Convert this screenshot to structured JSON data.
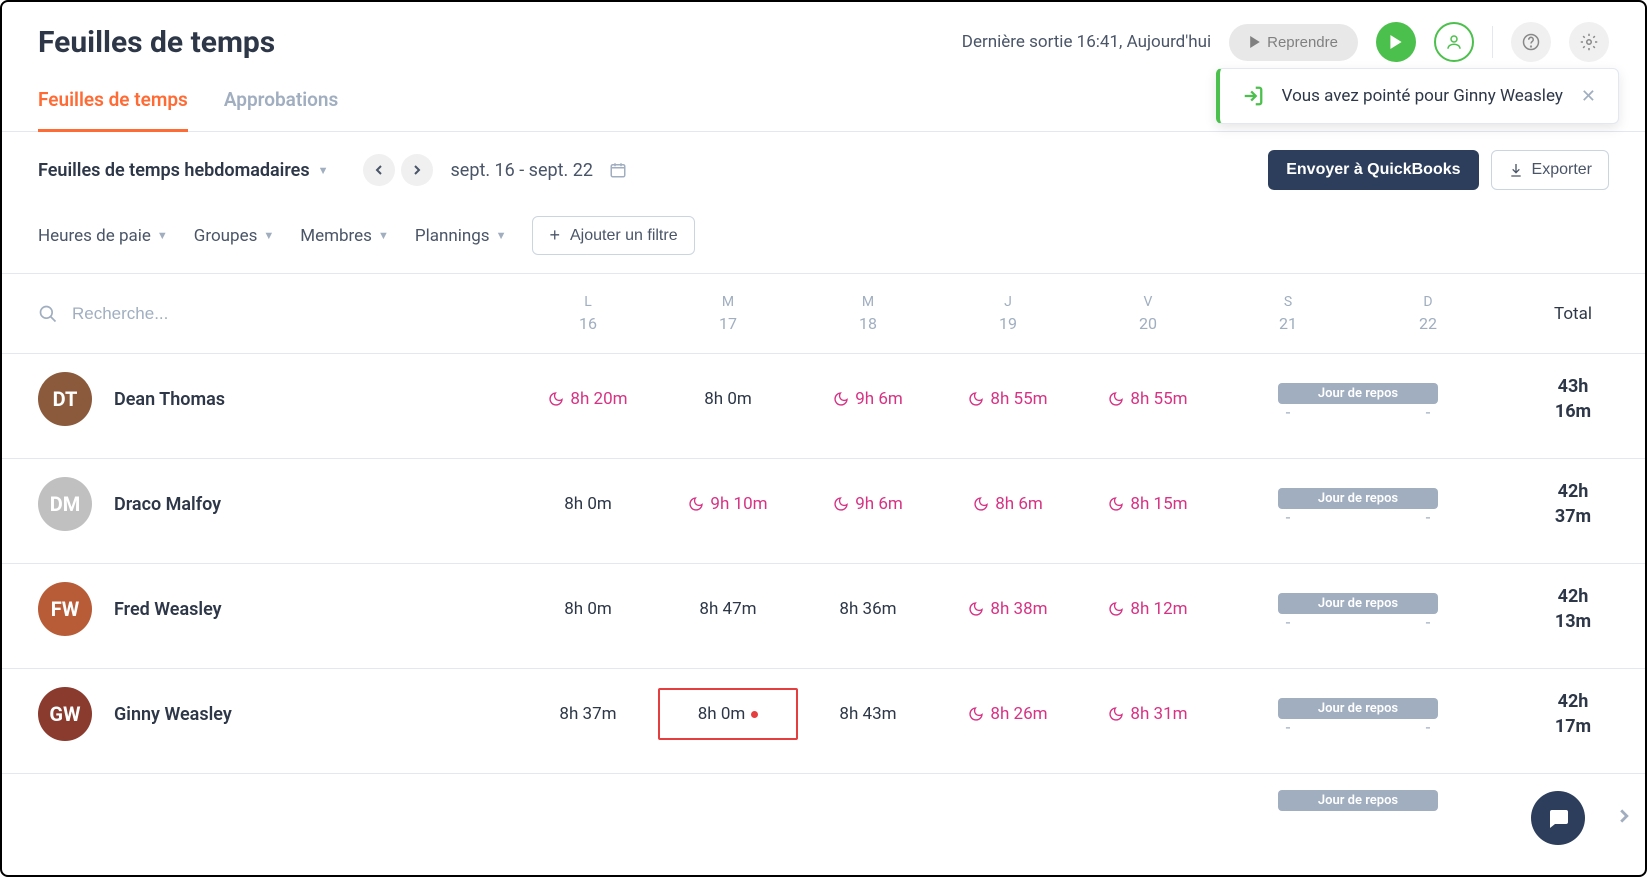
{
  "header": {
    "title": "Feuilles de temps",
    "lastOut": "Dernière sortie 16:41, Aujourd'hui",
    "resumeLabel": "Reprendre"
  },
  "tabs": {
    "timesheets": "Feuilles de temps",
    "approvals": "Approbations"
  },
  "toast": {
    "text": "Vous avez pointé pour Ginny Weasley"
  },
  "toolbar": {
    "viewDropdown": "Feuilles de temps hebdomadaires",
    "dateRange": "sept. 16 - sept. 22",
    "sendQb": "Envoyer à QuickBooks",
    "export": "Exporter"
  },
  "filters": {
    "payHours": "Heures de paie",
    "groups": "Groupes",
    "members": "Membres",
    "plannings": "Plannings",
    "addFilter": "Ajouter un filtre"
  },
  "table": {
    "searchPlaceholder": "Recherche...",
    "totalLabel": "Total",
    "restLabel": "Jour de repos",
    "days": [
      {
        "abbr": "L",
        "num": "16"
      },
      {
        "abbr": "M",
        "num": "17"
      },
      {
        "abbr": "M",
        "num": "18"
      },
      {
        "abbr": "J",
        "num": "19"
      },
      {
        "abbr": "V",
        "num": "20"
      },
      {
        "abbr": "S",
        "num": "21"
      },
      {
        "abbr": "D",
        "num": "22"
      }
    ],
    "rows": [
      {
        "name": "Dean Thomas",
        "avatarColor": "#8b5a3c",
        "cells": [
          {
            "v": "8h 20m",
            "flag": true
          },
          {
            "v": "8h 0m",
            "flag": false
          },
          {
            "v": "9h 6m",
            "flag": true
          },
          {
            "v": "8h 55m",
            "flag": true
          },
          {
            "v": "8h 55m",
            "flag": true
          }
        ],
        "total": "43h 16m"
      },
      {
        "name": "Draco Malfoy",
        "avatarColor": "#c0c0c0",
        "cells": [
          {
            "v": "8h 0m",
            "flag": false
          },
          {
            "v": "9h 10m",
            "flag": true
          },
          {
            "v": "9h 6m",
            "flag": true
          },
          {
            "v": "8h 6m",
            "flag": true
          },
          {
            "v": "8h 15m",
            "flag": true
          }
        ],
        "total": "42h 37m"
      },
      {
        "name": "Fred Weasley",
        "avatarColor": "#b85c38",
        "cells": [
          {
            "v": "8h 0m",
            "flag": false
          },
          {
            "v": "8h 47m",
            "flag": false
          },
          {
            "v": "8h 36m",
            "flag": false
          },
          {
            "v": "8h 38m",
            "flag": true
          },
          {
            "v": "8h 12m",
            "flag": true
          }
        ],
        "total": "42h 13m"
      },
      {
        "name": "Ginny Weasley",
        "avatarColor": "#8b3a2e",
        "cells": [
          {
            "v": "8h 37m",
            "flag": false
          },
          {
            "v": "8h 0m",
            "flag": false,
            "highlight": true,
            "dot": true
          },
          {
            "v": "8h 43m",
            "flag": false
          },
          {
            "v": "8h 26m",
            "flag": true
          },
          {
            "v": "8h 31m",
            "flag": true
          }
        ],
        "total": "42h 17m"
      }
    ]
  }
}
